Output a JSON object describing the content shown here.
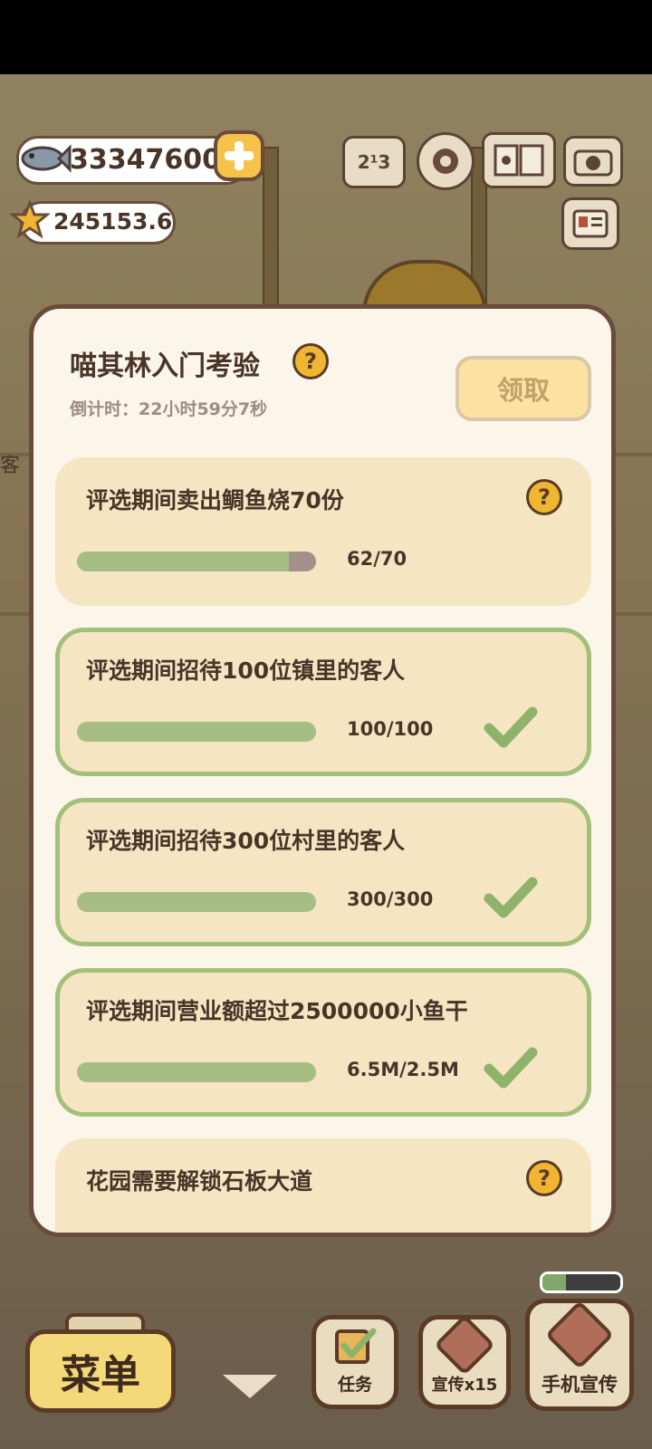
{
  "currency": {
    "fish": "33347600",
    "stars": "245153.6"
  },
  "top_icons": {
    "rank_label": "2¹3"
  },
  "side_label": "客",
  "panel": {
    "title": "喵其林入门考验",
    "countdown": "倒计时：22小时59分7秒",
    "claim_label": "领取",
    "tasks": [
      {
        "name": "评选期间卖出鲷鱼烧70份",
        "progress_text": "62/70",
        "progress": 0.886,
        "done": false
      },
      {
        "name": "评选期间招待100位镇里的客人",
        "progress_text": "100/100",
        "progress": 1.0,
        "done": true
      },
      {
        "name": "评选期间招待300位村里的客人",
        "progress_text": "300/300",
        "progress": 1.0,
        "done": true
      },
      {
        "name": "评选期间营业额超过2500000小鱼干",
        "progress_text": "6.5M/2.5M",
        "progress": 1.0,
        "done": true
      },
      {
        "name": "花园需要解锁石板大道",
        "progress_text": "",
        "progress": 0,
        "done": false
      }
    ]
  },
  "bottom": {
    "menu_label": "菜单",
    "tasks_label": "任务",
    "promo_label": "宣传x15",
    "phone_promo_label": "手机宣传"
  },
  "colors": {
    "panel_bg": "#fbf5ea",
    "task_bg": "#f6e5c3",
    "done_border": "#a3c07a",
    "bar_fill": "#a6bd83",
    "bar_empty": "#a39088",
    "accent_gold": "#f0b632"
  }
}
